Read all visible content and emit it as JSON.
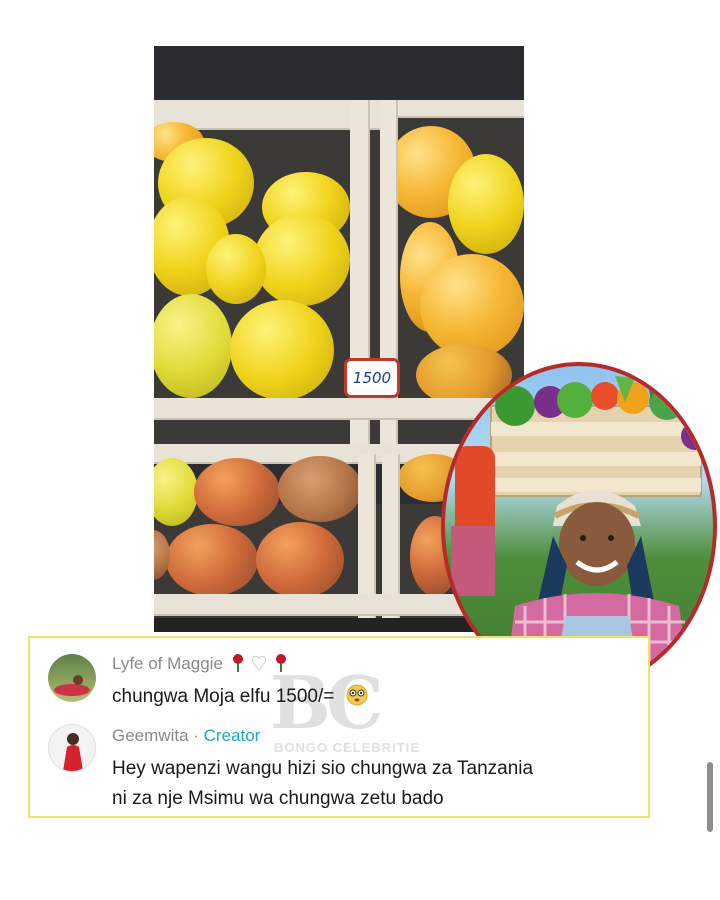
{
  "image": {
    "price_tag": "1500"
  },
  "comments": [
    {
      "username": "Lyfe of Maggie",
      "username_icons": [
        "rose-icon",
        "white-heart-icon",
        "rose-icon"
      ],
      "text": "chungwa Moja elfu 1500/=",
      "emoji": "flushed-face-icon"
    },
    {
      "username": "Geemwita",
      "separator": " · ",
      "badge": "Creator",
      "text_line1": "Hey wapenzi wangu hizi sio chungwa za Tanzania",
      "text_line2": "ni za nje Msimu wa chungwa zetu bado"
    }
  ],
  "watermark": {
    "logo": "BC",
    "text": "BONGO CELEBRITIE"
  },
  "colors": {
    "card_border": "#f3e25e",
    "creator_badge": "#1fa6c2",
    "inset_border": "#b52b2b",
    "price_tag_border": "#c0392b"
  }
}
